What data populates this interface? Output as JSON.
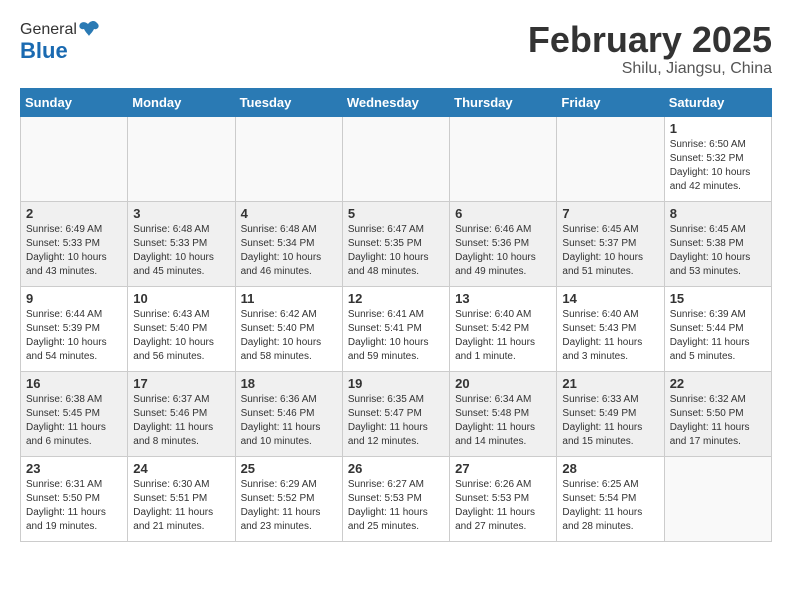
{
  "header": {
    "logo_general": "General",
    "logo_blue": "Blue",
    "month_title": "February 2025",
    "subtitle": "Shilu, Jiangsu, China"
  },
  "weekdays": [
    "Sunday",
    "Monday",
    "Tuesday",
    "Wednesday",
    "Thursday",
    "Friday",
    "Saturday"
  ],
  "weeks": [
    [
      {
        "day": "",
        "info": ""
      },
      {
        "day": "",
        "info": ""
      },
      {
        "day": "",
        "info": ""
      },
      {
        "day": "",
        "info": ""
      },
      {
        "day": "",
        "info": ""
      },
      {
        "day": "",
        "info": ""
      },
      {
        "day": "1",
        "info": "Sunrise: 6:50 AM\nSunset: 5:32 PM\nDaylight: 10 hours\nand 42 minutes."
      }
    ],
    [
      {
        "day": "2",
        "info": "Sunrise: 6:49 AM\nSunset: 5:33 PM\nDaylight: 10 hours\nand 43 minutes."
      },
      {
        "day": "3",
        "info": "Sunrise: 6:48 AM\nSunset: 5:33 PM\nDaylight: 10 hours\nand 45 minutes."
      },
      {
        "day": "4",
        "info": "Sunrise: 6:48 AM\nSunset: 5:34 PM\nDaylight: 10 hours\nand 46 minutes."
      },
      {
        "day": "5",
        "info": "Sunrise: 6:47 AM\nSunset: 5:35 PM\nDaylight: 10 hours\nand 48 minutes."
      },
      {
        "day": "6",
        "info": "Sunrise: 6:46 AM\nSunset: 5:36 PM\nDaylight: 10 hours\nand 49 minutes."
      },
      {
        "day": "7",
        "info": "Sunrise: 6:45 AM\nSunset: 5:37 PM\nDaylight: 10 hours\nand 51 minutes."
      },
      {
        "day": "8",
        "info": "Sunrise: 6:45 AM\nSunset: 5:38 PM\nDaylight: 10 hours\nand 53 minutes."
      }
    ],
    [
      {
        "day": "9",
        "info": "Sunrise: 6:44 AM\nSunset: 5:39 PM\nDaylight: 10 hours\nand 54 minutes."
      },
      {
        "day": "10",
        "info": "Sunrise: 6:43 AM\nSunset: 5:40 PM\nDaylight: 10 hours\nand 56 minutes."
      },
      {
        "day": "11",
        "info": "Sunrise: 6:42 AM\nSunset: 5:40 PM\nDaylight: 10 hours\nand 58 minutes."
      },
      {
        "day": "12",
        "info": "Sunrise: 6:41 AM\nSunset: 5:41 PM\nDaylight: 10 hours\nand 59 minutes."
      },
      {
        "day": "13",
        "info": "Sunrise: 6:40 AM\nSunset: 5:42 PM\nDaylight: 11 hours\nand 1 minute."
      },
      {
        "day": "14",
        "info": "Sunrise: 6:40 AM\nSunset: 5:43 PM\nDaylight: 11 hours\nand 3 minutes."
      },
      {
        "day": "15",
        "info": "Sunrise: 6:39 AM\nSunset: 5:44 PM\nDaylight: 11 hours\nand 5 minutes."
      }
    ],
    [
      {
        "day": "16",
        "info": "Sunrise: 6:38 AM\nSunset: 5:45 PM\nDaylight: 11 hours\nand 6 minutes."
      },
      {
        "day": "17",
        "info": "Sunrise: 6:37 AM\nSunset: 5:46 PM\nDaylight: 11 hours\nand 8 minutes."
      },
      {
        "day": "18",
        "info": "Sunrise: 6:36 AM\nSunset: 5:46 PM\nDaylight: 11 hours\nand 10 minutes."
      },
      {
        "day": "19",
        "info": "Sunrise: 6:35 AM\nSunset: 5:47 PM\nDaylight: 11 hours\nand 12 minutes."
      },
      {
        "day": "20",
        "info": "Sunrise: 6:34 AM\nSunset: 5:48 PM\nDaylight: 11 hours\nand 14 minutes."
      },
      {
        "day": "21",
        "info": "Sunrise: 6:33 AM\nSunset: 5:49 PM\nDaylight: 11 hours\nand 15 minutes."
      },
      {
        "day": "22",
        "info": "Sunrise: 6:32 AM\nSunset: 5:50 PM\nDaylight: 11 hours\nand 17 minutes."
      }
    ],
    [
      {
        "day": "23",
        "info": "Sunrise: 6:31 AM\nSunset: 5:50 PM\nDaylight: 11 hours\nand 19 minutes."
      },
      {
        "day": "24",
        "info": "Sunrise: 6:30 AM\nSunset: 5:51 PM\nDaylight: 11 hours\nand 21 minutes."
      },
      {
        "day": "25",
        "info": "Sunrise: 6:29 AM\nSunset: 5:52 PM\nDaylight: 11 hours\nand 23 minutes."
      },
      {
        "day": "26",
        "info": "Sunrise: 6:27 AM\nSunset: 5:53 PM\nDaylight: 11 hours\nand 25 minutes."
      },
      {
        "day": "27",
        "info": "Sunrise: 6:26 AM\nSunset: 5:53 PM\nDaylight: 11 hours\nand 27 minutes."
      },
      {
        "day": "28",
        "info": "Sunrise: 6:25 AM\nSunset: 5:54 PM\nDaylight: 11 hours\nand 28 minutes."
      },
      {
        "day": "",
        "info": ""
      }
    ]
  ]
}
